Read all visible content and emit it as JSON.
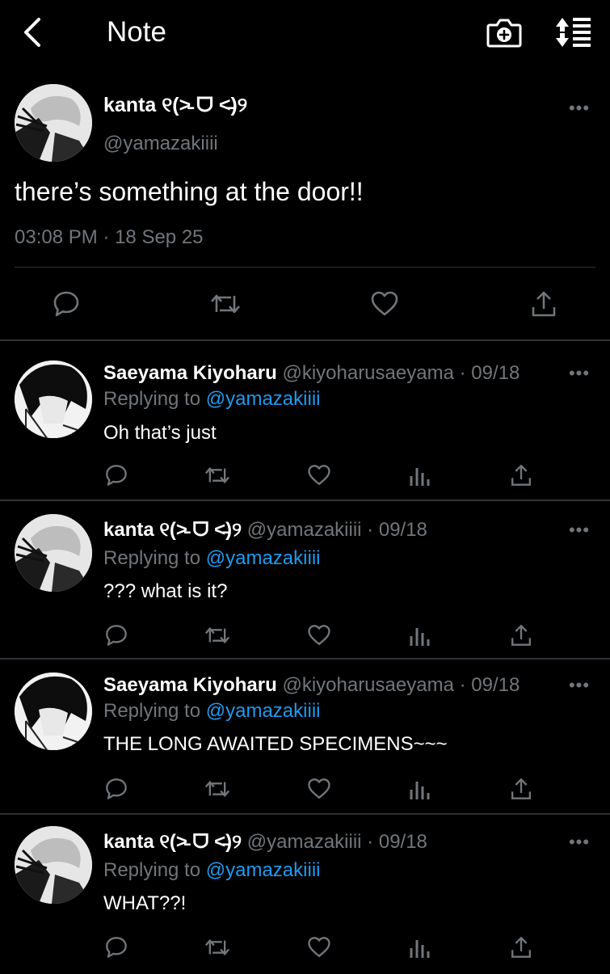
{
  "header": {
    "title": "Note",
    "back_icon": "chevron-left-icon",
    "camera_icon": "camera-add-icon",
    "sort_icon": "sort-list-icon"
  },
  "main_tweet": {
    "author_name": "kanta ୧(˃̵ ᗜ ˂̵)୨",
    "author_handle": "@yamazakiiii",
    "text": "there’s something at the door!!",
    "time": "03:08 PM",
    "date": "18 Sep 25",
    "separator": "·"
  },
  "replies": [
    {
      "name": "Saeyama Kiyoharu",
      "handle": "@kiyoharusaeyama",
      "date": "09/18",
      "replying_label": "Replying to",
      "replying_to": "@yamazakiiii",
      "text": "Oh that’s just"
    },
    {
      "name": "kanta ୧(˃̵ ᗜ ˂̵)୨",
      "handle": "@yamazakiiii",
      "date": "09/18",
      "replying_label": "Replying to",
      "replying_to": "@yamazakiiii",
      "text": "??? what is it?"
    },
    {
      "name": "Saeyama Kiyoharu",
      "handle": "@kiyoharusaeyama",
      "date": "09/18",
      "replying_label": "Replying to",
      "replying_to": "@yamazakiiii",
      "text": "THE LONG AWAITED SPECIMENS~~~"
    },
    {
      "name": "kanta ୧(˃̵ ᗜ ˂̵)୨",
      "handle": "@yamazakiiii",
      "date": "09/18",
      "replying_label": "Replying to",
      "replying_to": "@yamazakiiii",
      "text": "WHAT??!"
    }
  ],
  "more_glyph": "•••",
  "colors": {
    "background": "#000000",
    "text": "#ffffff",
    "muted": "#71767b",
    "link": "#1d9bf0",
    "divider": "#2f3336"
  }
}
